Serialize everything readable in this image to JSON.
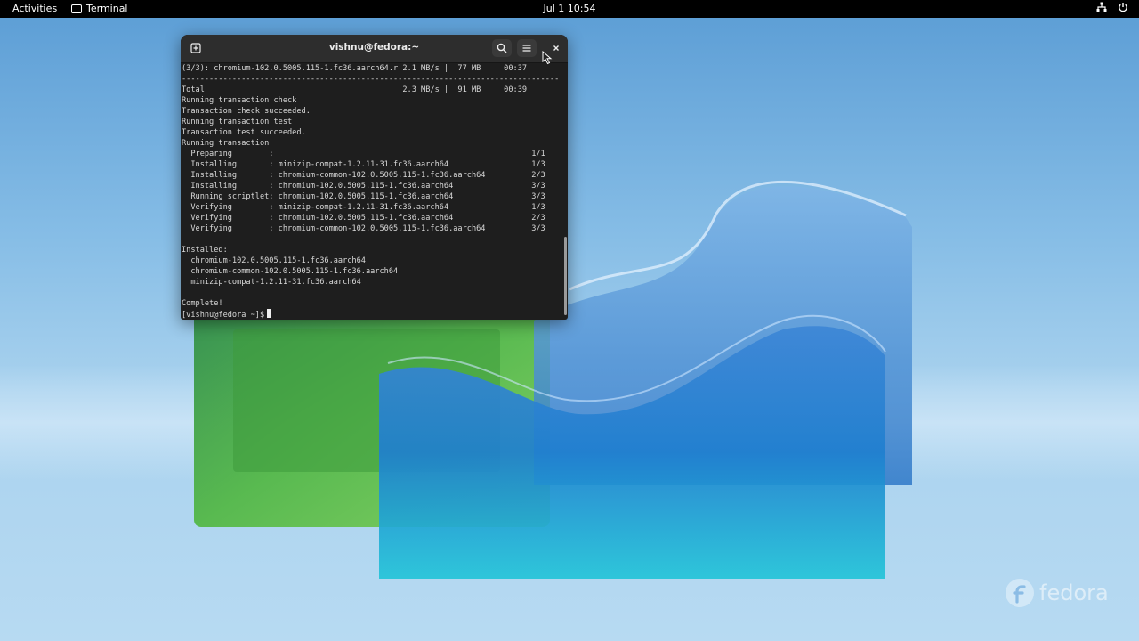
{
  "topbar": {
    "activities": "Activities",
    "app_name": "Terminal",
    "clock": "Jul 1  10:54"
  },
  "terminal": {
    "title": "vishnu@fedora:~",
    "lines": [
      "(3/3): chromium-102.0.5005.115-1.fc36.aarch64.r 2.1 MB/s |  77 MB     00:37",
      "----------------------------------------------------------------------------------",
      "Total                                           2.3 MB/s |  91 MB     00:39",
      "Running transaction check",
      "Transaction check succeeded.",
      "Running transaction test",
      "Transaction test succeeded.",
      "Running transaction",
      "  Preparing        :                                                        1/1",
      "  Installing       : minizip-compat-1.2.11-31.fc36.aarch64                  1/3",
      "  Installing       : chromium-common-102.0.5005.115-1.fc36.aarch64          2/3",
      "  Installing       : chromium-102.0.5005.115-1.fc36.aarch64                 3/3",
      "  Running scriptlet: chromium-102.0.5005.115-1.fc36.aarch64                 3/3",
      "  Verifying        : minizip-compat-1.2.11-31.fc36.aarch64                  1/3",
      "  Verifying        : chromium-102.0.5005.115-1.fc36.aarch64                 2/3",
      "  Verifying        : chromium-common-102.0.5005.115-1.fc36.aarch64          3/3",
      "",
      "Installed:",
      "  chromium-102.0.5005.115-1.fc36.aarch64",
      "  chromium-common-102.0.5005.115-1.fc36.aarch64",
      "  minizip-compat-1.2.11-31.fc36.aarch64",
      "",
      "Complete!"
    ],
    "prompt": "[vishnu@fedora ~]$"
  },
  "icons": {
    "new_tab": "new-tab-icon",
    "search": "search-icon",
    "menu": "hamburger-menu-icon",
    "close": "close-icon",
    "network": "network-icon",
    "power": "power-icon"
  },
  "watermark": {
    "brand": "fedora"
  },
  "colors": {
    "terminal_bg": "#1e1e1e",
    "titlebar_bg": "#2d2d2d",
    "terminal_text": "#d8d8d8",
    "topbar_bg": "#000000"
  }
}
